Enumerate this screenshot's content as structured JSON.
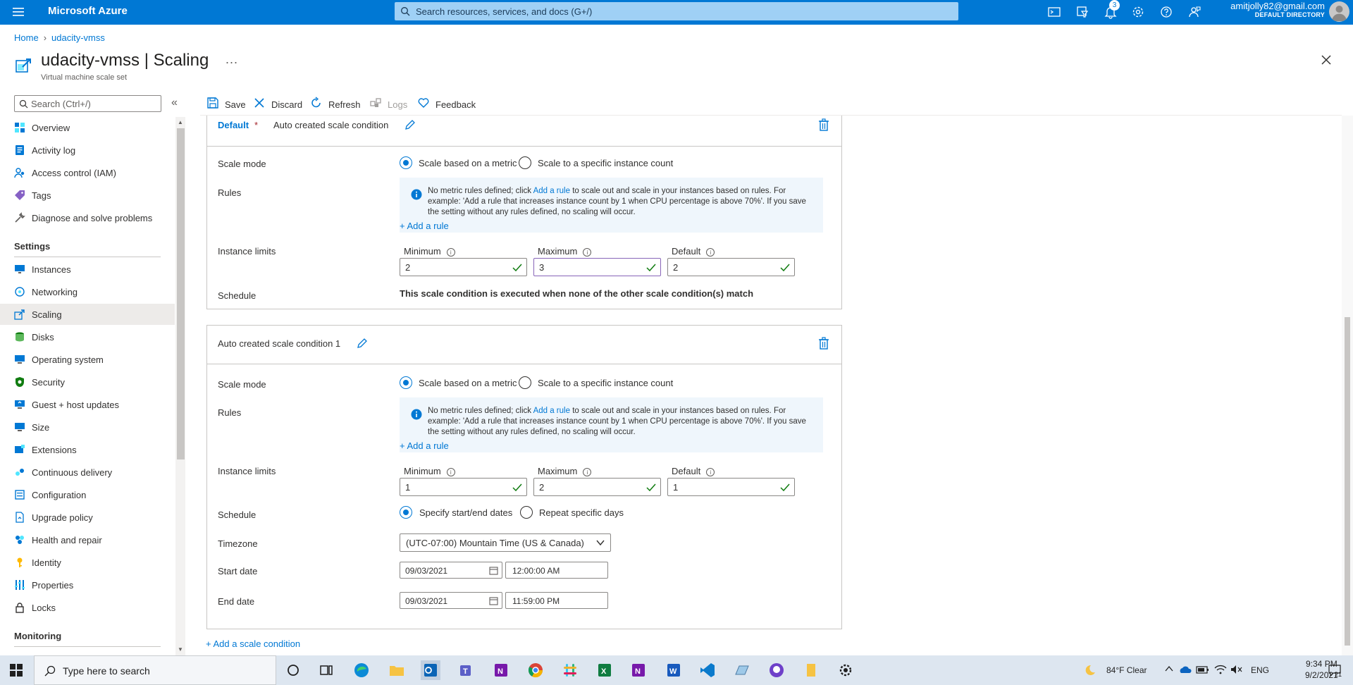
{
  "topbar": {
    "brand": "Microsoft Azure",
    "search_placeholder": "Search resources, services, and docs (G+/)",
    "notification_count": "3",
    "account_email": "amitjolly82@gmail.com",
    "account_directory": "DEFAULT DIRECTORY"
  },
  "breadcrumb": {
    "home": "Home",
    "resource": "udacity-vmss"
  },
  "page": {
    "title": "udacity-vmss | Scaling",
    "subtitle": "Virtual machine scale set",
    "more": "..."
  },
  "sidebar": {
    "search_placeholder": "Search (Ctrl+/)",
    "collapse_glyph": "«",
    "items_top": [
      "Overview",
      "Activity log",
      "Access control (IAM)",
      "Tags",
      "Diagnose and solve problems"
    ],
    "settings_header": "Settings",
    "items_settings": [
      "Instances",
      "Networking",
      "Scaling",
      "Disks",
      "Operating system",
      "Security",
      "Guest + host updates",
      "Size",
      "Extensions",
      "Continuous delivery",
      "Configuration",
      "Upgrade policy",
      "Health and repair",
      "Identity",
      "Properties",
      "Locks"
    ],
    "monitoring_header": "Monitoring"
  },
  "toolbar": {
    "save": "Save",
    "discard": "Discard",
    "refresh": "Refresh",
    "logs": "Logs",
    "feedback": "Feedback"
  },
  "default_condition": {
    "tag": "Default",
    "star": "*",
    "name": "Auto created scale condition",
    "scale_mode_label": "Scale mode",
    "mode_metric": "Scale based on a metric",
    "mode_count": "Scale to a specific instance count",
    "rules_label": "Rules",
    "info_pre": "No metric rules defined; click ",
    "info_link": "Add a rule",
    "info_post": " to scale out and scale in your instances based on rules. For example: 'Add a rule that increases instance count by 1 when CPU percentage is above 70%'. If you save the setting without any rules defined, no scaling will occur.",
    "add_rule": "+ Add a rule",
    "limits_label": "Instance limits",
    "min_label": "Minimum",
    "max_label": "Maximum",
    "def_label": "Default",
    "min_value": "2",
    "max_value": "3",
    "def_value": "2",
    "schedule_label": "Schedule",
    "schedule_text": "This scale condition is executed when none of the other scale condition(s) match"
  },
  "condition_1": {
    "name": "Auto created scale condition 1",
    "scale_mode_label": "Scale mode",
    "mode_metric": "Scale based on a metric",
    "mode_count": "Scale to a specific instance count",
    "rules_label": "Rules",
    "info_pre": "No metric rules defined; click ",
    "info_link": "Add a rule",
    "info_post": " to scale out and scale in your instances based on rules. For example: 'Add a rule that increases instance count by 1 when CPU percentage is above 70%'. If you save the setting without any rules defined, no scaling will occur.",
    "add_rule": "+ Add a rule",
    "limits_label": "Instance limits",
    "min_label": "Minimum",
    "max_label": "Maximum",
    "def_label": "Default",
    "min_value": "1",
    "max_value": "2",
    "def_value": "1",
    "schedule_label": "Schedule",
    "sched_dates": "Specify start/end dates",
    "sched_days": "Repeat specific days",
    "timezone_label": "Timezone",
    "timezone_value": "(UTC-07:00) Mountain Time (US & Canada)",
    "start_label": "Start date",
    "start_date": "09/03/2021",
    "start_time": "12:00:00 AM",
    "end_label": "End date",
    "end_date": "09/03/2021",
    "end_time": "11:59:00 PM"
  },
  "add_scale_condition": "+ Add a scale condition",
  "taskbar": {
    "search_placeholder": "Type here to search",
    "weather": "84°F  Clear",
    "lang": "ENG",
    "time": "9:34 PM",
    "date": "9/2/2021",
    "notif_count": "21"
  },
  "colors": {
    "azure_blue": "#0078d4",
    "success_green": "#107c10",
    "focus_purple": "#8764b8",
    "delete_blue": "#0078d4"
  }
}
